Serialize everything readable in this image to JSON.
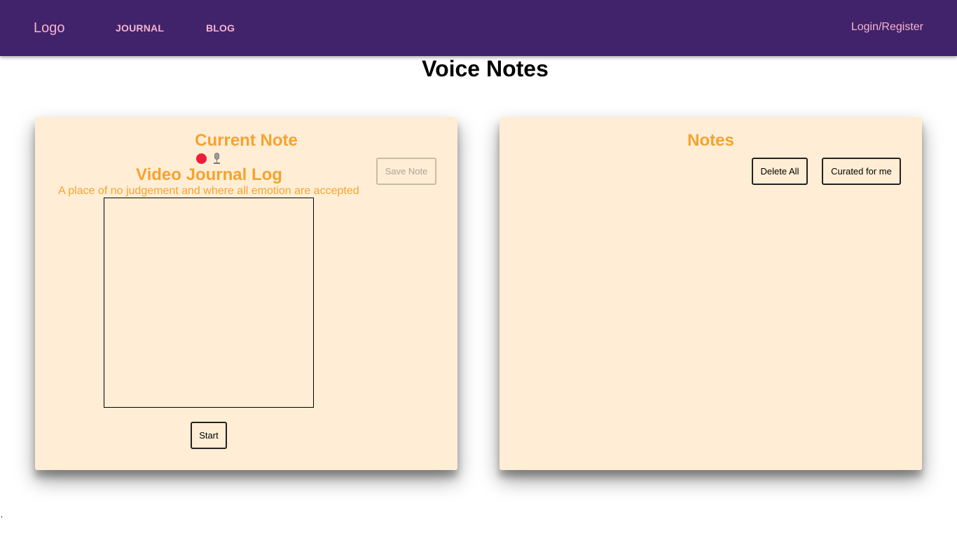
{
  "navbar": {
    "logo": "Logo",
    "links": [
      "JOURNAL",
      "BLOG"
    ],
    "login": "Login/Register"
  },
  "page": {
    "title": "Voice Notes"
  },
  "current_note": {
    "heading": "Current Note",
    "record_icon": "record-dot-icon",
    "mic_icon": "microphone-icon",
    "save_label": "Save Note",
    "sub_heading": "Video Journal Log",
    "tagline": "A place of no judgement and where all emotion are accepted",
    "start_label": "Start"
  },
  "notes": {
    "heading": "Notes",
    "delete_label": "Delete All",
    "curated_label": "Curated for me"
  },
  "footer": {
    "stray": ","
  },
  "colors": {
    "navbar_bg": "#40236a",
    "nav_text": "#f6b3d0",
    "panel_bg": "#ffeed5",
    "accent": "#f6a22f",
    "record": "#ef1c3a"
  }
}
